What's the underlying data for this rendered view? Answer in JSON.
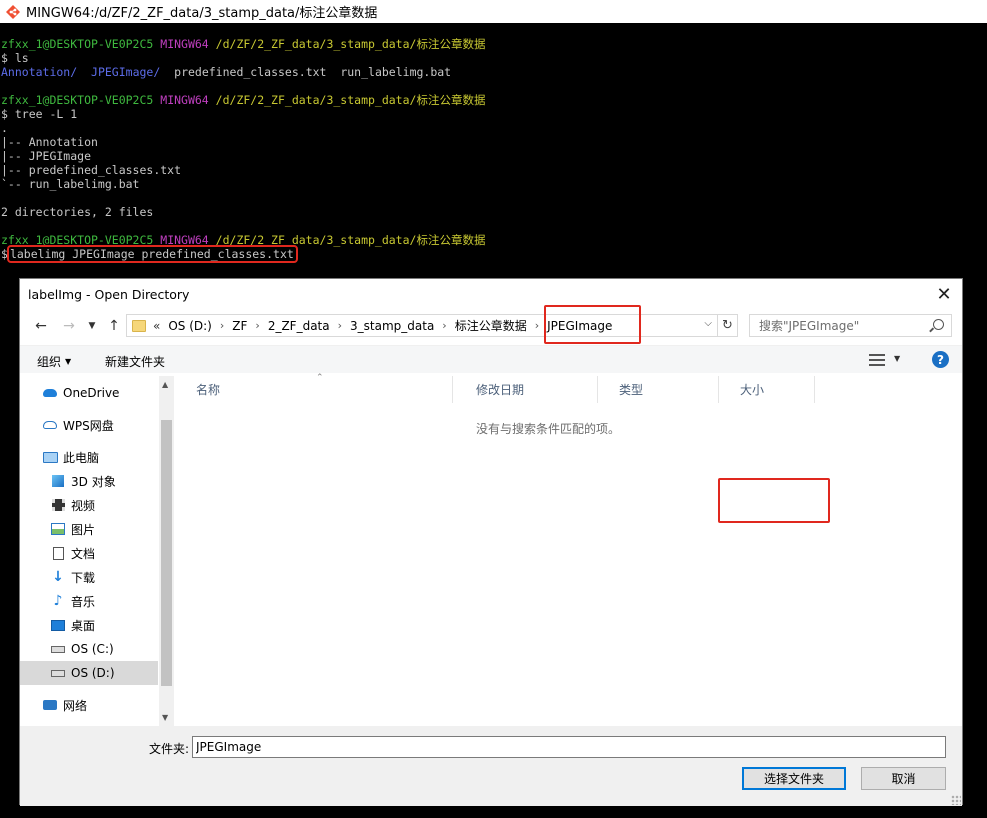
{
  "terminal": {
    "window_title": "MINGW64:/d/ZF/2_ZF_data/3_stamp_data/标注公章数据",
    "prompt_user": "zfxx_1@DESKTOP-VE0P2C5",
    "prompt_shell": "MINGW64",
    "prompt_path": "/d/ZF/2_ZF_data/3_stamp_data/标注公章数据",
    "cmd_ls": "$ ls",
    "ls_dir1": "Annotation/",
    "ls_dir2": "JPEGImage/",
    "ls_file1": "predefined_classes.txt",
    "ls_file2": "run_labelimg.bat",
    "cmd_tree": "$ tree -L 1",
    "tree_root": ".",
    "tree_lines": [
      "|-- Annotation",
      "|-- JPEGImage",
      "|-- predefined_classes.txt",
      "`-- run_labelimg.bat"
    ],
    "tree_summary": "2 directories, 2 files",
    "prompt_symbol": "$",
    "cmd_labelimg": "labelimg JPEGImage predefined_classes.txt"
  },
  "dialog": {
    "title": "labelImg - Open Directory",
    "close": "✕",
    "address": {
      "overflow": "«",
      "crumbs": [
        "OS (D:)",
        "ZF",
        "2_ZF_data",
        "3_stamp_data",
        "标注公章数据",
        "JPEGImage"
      ],
      "separator": "›"
    },
    "search_placeholder": "搜索\"JPEGImage\"",
    "toolbar": {
      "organize": "组织",
      "new_folder": "新建文件夹",
      "help": "?"
    },
    "nav_items": [
      {
        "label": "OneDrive",
        "icon": "onedrive-icon"
      },
      {
        "label": "WPS网盘",
        "icon": "wps-cloud-icon"
      },
      {
        "label": "此电脑",
        "icon": "computer-icon"
      },
      {
        "label": "3D 对象",
        "icon": "3d-objects-icon"
      },
      {
        "label": "视频",
        "icon": "video-icon"
      },
      {
        "label": "图片",
        "icon": "pictures-icon"
      },
      {
        "label": "文档",
        "icon": "documents-icon"
      },
      {
        "label": "下载",
        "icon": "download-icon"
      },
      {
        "label": "音乐",
        "icon": "music-icon"
      },
      {
        "label": "桌面",
        "icon": "desktop-icon"
      },
      {
        "label": "OS (C:)",
        "icon": "drive-icon"
      },
      {
        "label": "OS (D:)",
        "icon": "drive-icon"
      },
      {
        "label": "网络",
        "icon": "network-icon"
      }
    ],
    "columns": [
      "名称",
      "修改日期",
      "类型",
      "大小"
    ],
    "empty_message": "没有与搜索条件匹配的项。",
    "folder_label": "文件夹:",
    "folder_value": "JPEGImage",
    "select_button": "选择文件夹",
    "cancel_button": "取消"
  },
  "colors": {
    "highlight_box": "#e0281e",
    "prompt_green": "#3fb93f",
    "prompt_magenta": "#bf3fbf",
    "prompt_yellow": "#c8c832",
    "dir_blue": "#5c6ce8"
  }
}
